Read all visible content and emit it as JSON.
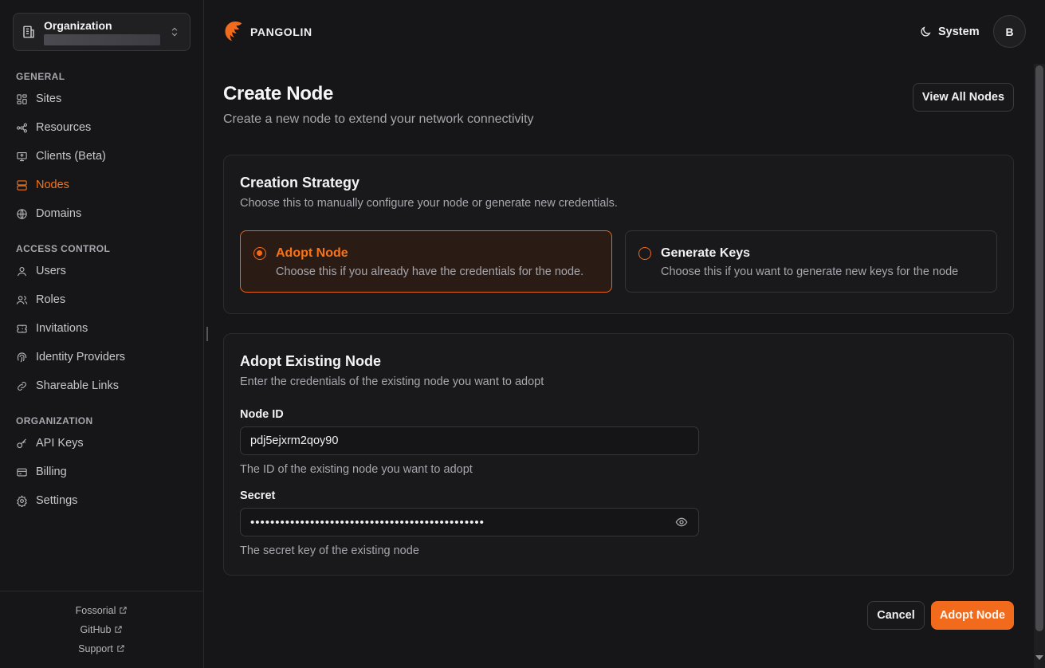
{
  "organization": {
    "title": "Organization"
  },
  "nav": {
    "general_label": "GENERAL",
    "general": [
      {
        "label": "Sites",
        "icon": "sites-icon"
      },
      {
        "label": "Resources",
        "icon": "resources-icon"
      },
      {
        "label": "Clients (Beta)",
        "icon": "monitor-icon"
      },
      {
        "label": "Nodes",
        "icon": "server-icon",
        "active": true
      },
      {
        "label": "Domains",
        "icon": "globe-icon"
      }
    ],
    "access_label": "ACCESS CONTROL",
    "access": [
      {
        "label": "Users",
        "icon": "user-icon"
      },
      {
        "label": "Roles",
        "icon": "users-icon"
      },
      {
        "label": "Invitations",
        "icon": "ticket-icon"
      },
      {
        "label": "Identity Providers",
        "icon": "fingerprint-icon"
      },
      {
        "label": "Shareable Links",
        "icon": "link-icon"
      }
    ],
    "org_label": "ORGANIZATION",
    "org": [
      {
        "label": "API Keys",
        "icon": "key-icon"
      },
      {
        "label": "Billing",
        "icon": "billing-icon"
      },
      {
        "label": "Settings",
        "icon": "gear-icon"
      }
    ]
  },
  "footer": {
    "links": [
      "Fossorial",
      "GitHub",
      "Support"
    ]
  },
  "header": {
    "brand": "PANGOLIN",
    "theme_label": "System",
    "avatar_initial": "B"
  },
  "page": {
    "title": "Create Node",
    "subtitle": "Create a new node to extend your network connectivity",
    "view_all_label": "View All Nodes"
  },
  "strategy": {
    "title": "Creation Strategy",
    "description": "Choose this to manually configure your node or generate new credentials.",
    "options": [
      {
        "title": "Adopt Node",
        "description": "Choose this if you already have the credentials for the node.",
        "selected": true
      },
      {
        "title": "Generate Keys",
        "description": "Choose this if you want to generate new keys for the node",
        "selected": false
      }
    ]
  },
  "adopt": {
    "title": "Adopt Existing Node",
    "description": "Enter the credentials of the existing node you want to adopt",
    "node_id_label": "Node ID",
    "node_id_value": "pdj5ejxrm2qoy90",
    "node_id_hint": "The ID of the existing node you want to adopt",
    "secret_label": "Secret",
    "secret_value": "•••••••••••••••••••••••••••••••••••••••••••••••",
    "secret_hint": "The secret key of the existing node"
  },
  "actions": {
    "cancel_label": "Cancel",
    "submit_label": "Adopt Node"
  },
  "colors": {
    "accent": "#f97316",
    "background": "#161618",
    "card": "#19191b"
  }
}
